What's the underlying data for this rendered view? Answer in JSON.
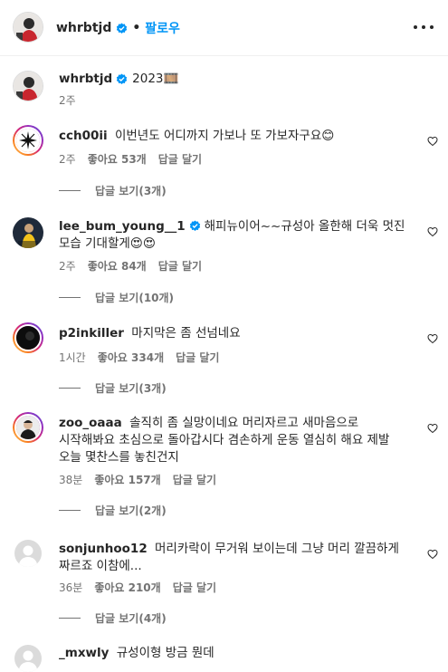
{
  "header": {
    "username": "whrbtjd",
    "separator": "•",
    "follow_label": "팔로우",
    "verified_icon": "verified-badge-icon",
    "more_icon": "more-options-icon"
  },
  "caption": {
    "username": "whrbtjd",
    "text": "2023🎞️",
    "time": "2주"
  },
  "comments": [
    {
      "username": "cch00ii",
      "text": "이번년도 어디까지 가보나 또 가보자구요😊",
      "time": "2주",
      "likes": "좋아요 53개",
      "reply": "답글 달기",
      "replies": "답글 보기(3개)"
    },
    {
      "username": "lee_bum_young__1",
      "text": "해피뉴이어~~규성아 올한해 더욱 멋진 모습 기대할게😍😍",
      "time": "2주",
      "likes": "좋아요 84개",
      "reply": "답글 달기",
      "replies": "답글 보기(10개)"
    },
    {
      "username": "p2inkiller",
      "text": "마지막은 좀 선넘네요",
      "time": "1시간",
      "likes": "좋아요 334개",
      "reply": "답글 달기",
      "replies": "답글 보기(3개)"
    },
    {
      "username": "zoo_oaaa",
      "text": "솔직히 좀 실망이네요 머리자르고 새마음으로 시작해봐요 초심으로 돌아갑시다 겸손하게 운동 열심히 해요 제발 오늘 몇찬스를 놓친건지",
      "time": "38분",
      "likes": "좋아요 157개",
      "reply": "답글 달기",
      "replies": "답글 보기(2개)"
    },
    {
      "username": "sonjunhoo12",
      "text": "머리카락이 무거워 보이는데 그냥 머리 깔끔하게 짜르죠 이참에...",
      "time": "36분",
      "likes": "좋아요 210개",
      "reply": "답글 달기",
      "replies": "답글 보기(4개)"
    },
    {
      "username": "_mxwly",
      "text": "규성이형 방금 뭔데"
    }
  ]
}
